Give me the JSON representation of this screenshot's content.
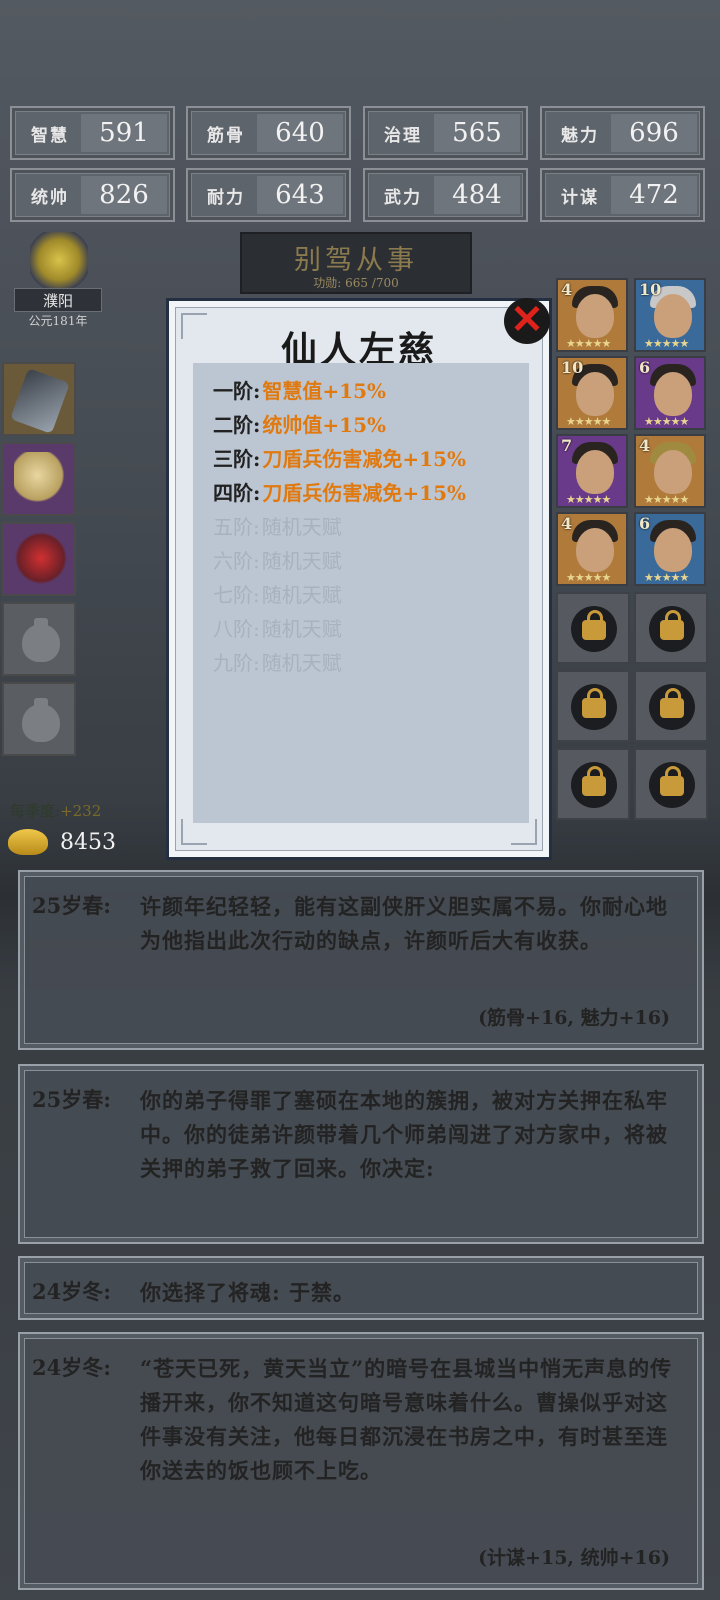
{
  "stats": [
    {
      "name": "智慧",
      "value": "591"
    },
    {
      "name": "筋骨",
      "value": "640"
    },
    {
      "name": "治理",
      "value": "565"
    },
    {
      "name": "魅力",
      "value": "696"
    },
    {
      "name": "统帅",
      "value": "826"
    },
    {
      "name": "耐力",
      "value": "643"
    },
    {
      "name": "武力",
      "value": "484"
    },
    {
      "name": "计谋",
      "value": "472"
    }
  ],
  "location": {
    "place": "濮阳",
    "year": "公元181年"
  },
  "rank": {
    "title": "别驾从事",
    "merit": "功勋: 665 /700"
  },
  "economy": {
    "season_label": "每季度:",
    "season_gain": "+232",
    "gold": "8453"
  },
  "heroes": [
    {
      "level": "4"
    },
    {
      "level": "10"
    },
    {
      "level": "10"
    },
    {
      "level": "6"
    },
    {
      "level": "7"
    },
    {
      "level": "4"
    },
    {
      "level": "4"
    },
    {
      "level": "6"
    }
  ],
  "talent_popup": {
    "title": "仙人左慈",
    "tiers": [
      {
        "label": "一阶:",
        "effect": "智慧值+15%",
        "unlocked": true
      },
      {
        "label": "二阶:",
        "effect": "统帅值+15%",
        "unlocked": true
      },
      {
        "label": "三阶:",
        "effect": "刀盾兵伤害减免+15%",
        "unlocked": true
      },
      {
        "label": "四阶:",
        "effect": "刀盾兵伤害减免+15%",
        "unlocked": true
      },
      {
        "label": "五阶:",
        "effect": "随机天赋",
        "unlocked": false
      },
      {
        "label": "六阶:",
        "effect": "随机天赋",
        "unlocked": false
      },
      {
        "label": "七阶:",
        "effect": "随机天赋",
        "unlocked": false
      },
      {
        "label": "八阶:",
        "effect": "随机天赋",
        "unlocked": false
      },
      {
        "label": "九阶:",
        "effect": "随机天赋",
        "unlocked": false
      }
    ]
  },
  "logs": [
    {
      "when": "25岁春:",
      "text": "许颜年纪轻轻，能有这副侠肝义胆实属不易。你耐心地为他指出此次行动的缺点，许颜听后大有收获。",
      "delta": "(筋骨+16, 魅力+16)"
    },
    {
      "when": "25岁春:",
      "text": "你的弟子得罪了塞硕在本地的簇拥，被对方关押在私牢中。你的徒弟许颜带着几个师弟闯进了对方家中，将被关押的弟子救了回来。你决定:",
      "delta": ""
    },
    {
      "when": "24岁冬:",
      "text": "你选择了将魂: 于禁。",
      "delta": ""
    },
    {
      "when": "24岁冬:",
      "text": "“苍天已死，黄天当立”的暗号在县城当中悄无声息的传播开来，你不知道这句暗号意味着什么。曹操似乎对这件事没有关注，他每日都沉浸在书房之中，有时甚至连你送去的饭也顾不上吃。",
      "delta": "(计谋+15, 统帅+16)"
    }
  ]
}
